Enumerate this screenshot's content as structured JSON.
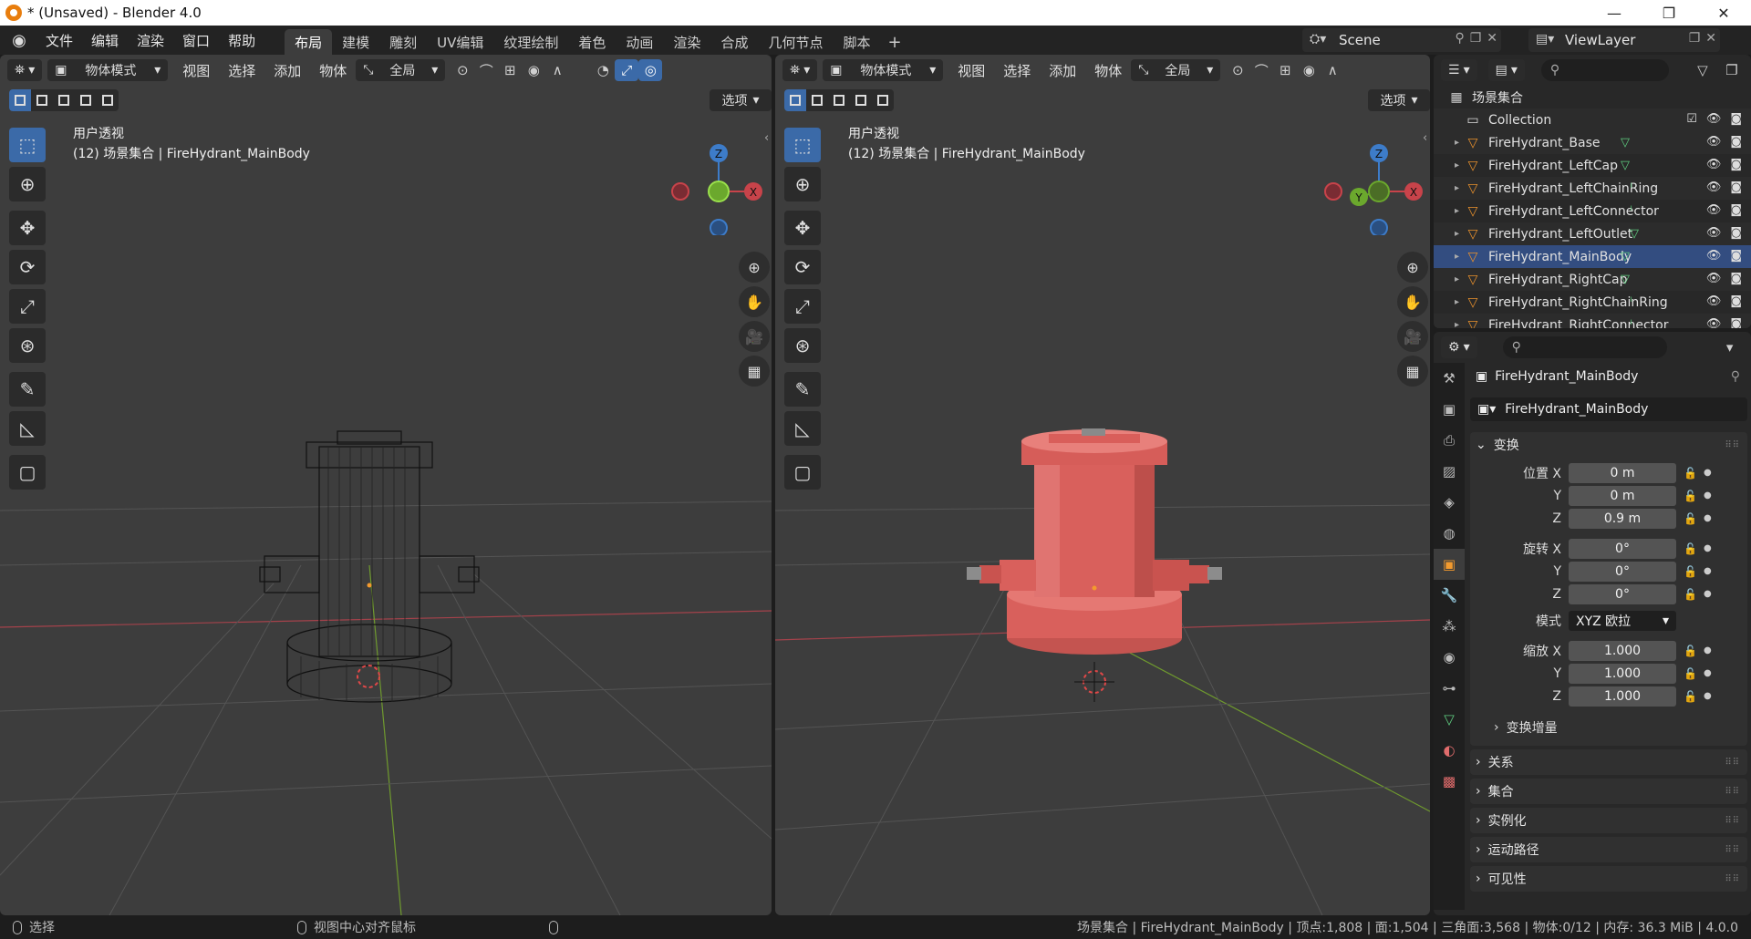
{
  "window": {
    "title": "* (Unsaved) - Blender 4.0",
    "minimize": "—",
    "maximize": "❐",
    "close": "✕"
  },
  "menu": [
    "文件",
    "编辑",
    "渲染",
    "窗口",
    "帮助"
  ],
  "workspaces": [
    "布局",
    "建模",
    "雕刻",
    "UV编辑",
    "纹理绘制",
    "着色",
    "动画",
    "渲染",
    "合成",
    "几何节点",
    "脚本"
  ],
  "workspace_add": "+",
  "scene": {
    "name": "Scene",
    "view_layer": "ViewLayer"
  },
  "viewport": {
    "mode": "物体模式",
    "menus": [
      "视图",
      "选择",
      "添加",
      "物体"
    ],
    "orientation": "全局",
    "options": "选项",
    "view_name": "用户透视",
    "view_context": "(12) 场景集合 | FireHydrant_MainBody"
  },
  "gizmo_labels": {
    "z": "Z",
    "y": "Y",
    "x": "X"
  },
  "outliner": {
    "root": "场景集合",
    "collection": "Collection",
    "items": [
      {
        "name": "FireHydrant_Base",
        "mesh_icon": true
      },
      {
        "name": "FireHydrant_LeftCap",
        "mesh_icon": true
      },
      {
        "name": "FireHydrant_LeftChainRing",
        "mesh_icon": false
      },
      {
        "name": "FireHydrant_LeftConnector",
        "mesh_icon": false
      },
      {
        "name": "FireHydrant_LeftOutlet",
        "mesh_icon": true
      },
      {
        "name": "FireHydrant_MainBody",
        "mesh_icon": true,
        "selected": true
      },
      {
        "name": "FireHydrant_RightCap",
        "mesh_icon": true
      },
      {
        "name": "FireHydrant_RightChainRing",
        "mesh_icon": false
      },
      {
        "name": "FireHydrant_RightConnector",
        "mesh_icon": false
      }
    ]
  },
  "properties": {
    "object_name": "FireHydrant_MainBody",
    "data_name": "FireHydrant_MainBody",
    "transform_title": "变换",
    "location_label": "位置 X",
    "rotation_label": "旋转 X",
    "scale_label": "缩放 X",
    "y_label": "Y",
    "z_label": "Z",
    "location": [
      "0 m",
      "0 m",
      "0.9 m"
    ],
    "rotation": [
      "0°",
      "0°",
      "0°"
    ],
    "mode_label": "模式",
    "mode_value": "XYZ 欧拉",
    "scale": [
      "1.000",
      "1.000",
      "1.000"
    ],
    "delta_transform": "变换增量",
    "panels": [
      "关系",
      "集合",
      "实例化",
      "运动路径",
      "可见性"
    ]
  },
  "statusbar": {
    "select": "选择",
    "center_view": "视图中心对齐鼠标",
    "stats": "场景集合 | FireHydrant_MainBody | 顶点:1,808 | 面:1,504 | 三角面:3,568 | 物体:0/12 | 内存: 36.3 MiB | 4.0.0"
  },
  "colors": {
    "accent": "#3b6aa8",
    "hydrant_red": "#d9605c",
    "axis_x": "#c8434a",
    "axis_y": "#6ba82d",
    "axis_z": "#3d7cc9"
  }
}
